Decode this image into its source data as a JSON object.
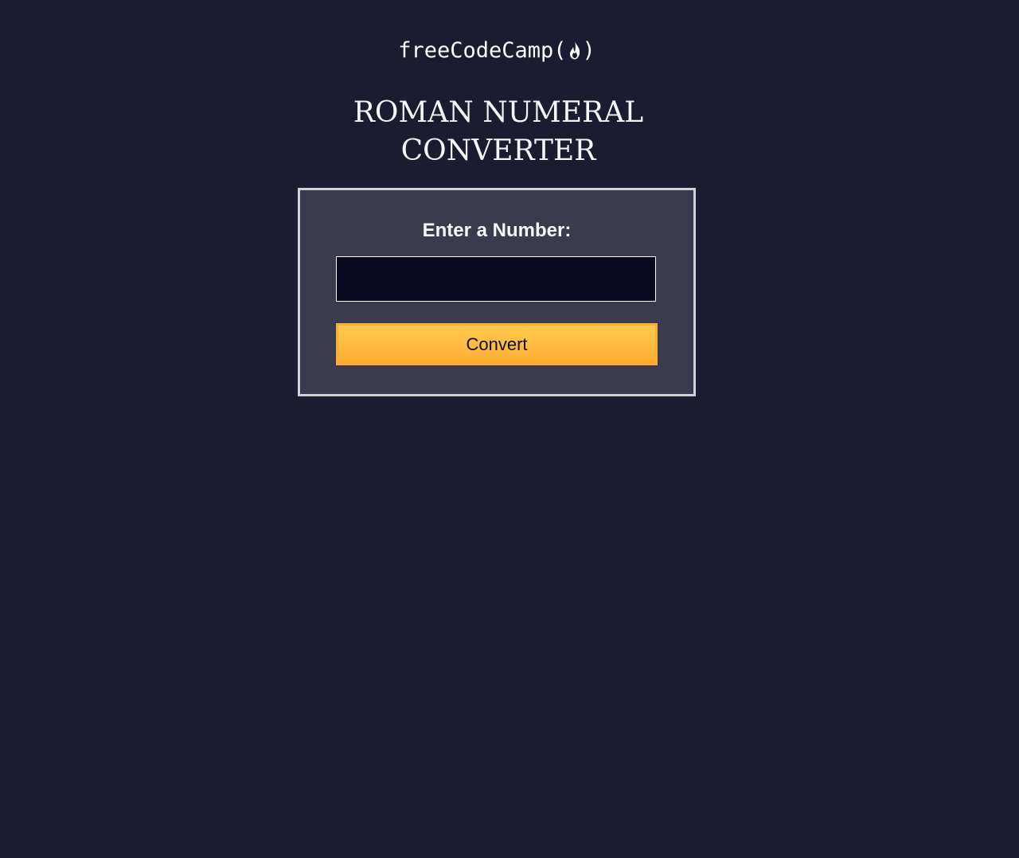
{
  "logo": {
    "prefix": "freeCodeCamp(",
    "suffix": ")",
    "icon": "flame-icon"
  },
  "title": {
    "line1": "ROMAN NUMERAL",
    "line2": "CONVERTER"
  },
  "form": {
    "label": "Enter a Number:",
    "input_value": "",
    "input_placeholder": "",
    "button_label": "Convert"
  },
  "colors": {
    "background": "#1b1b32",
    "card": "#3b3b4f",
    "input_bg": "#0a0a23",
    "button_top": "#fecc4c",
    "button_bottom": "#ffac33"
  }
}
